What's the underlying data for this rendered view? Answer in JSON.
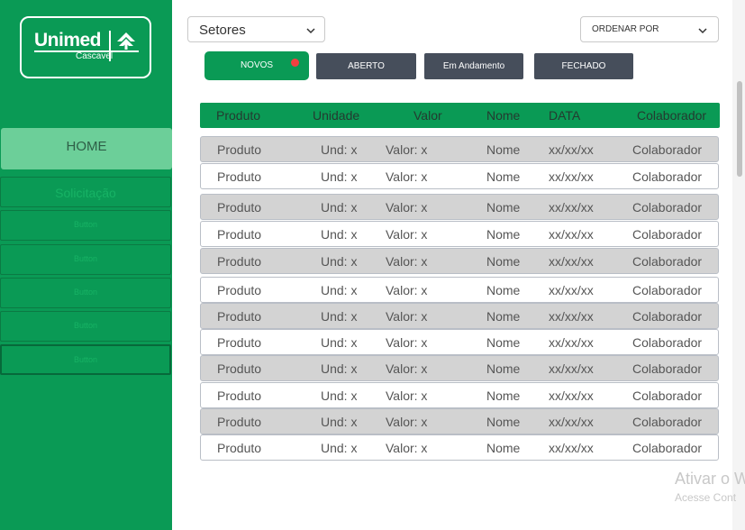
{
  "sidebar": {
    "logo": {
      "brand": "Unimed",
      "sub": "Cascavel"
    },
    "home_label": "HOME",
    "items": [
      {
        "label": "Solicitação"
      },
      {
        "label": "Button"
      },
      {
        "label": "Button"
      },
      {
        "label": "Button"
      },
      {
        "label": "Button"
      },
      {
        "label": "Button"
      }
    ]
  },
  "filters": {
    "setores": "Setores",
    "ordenar": "ORDENAR POR"
  },
  "tabs": {
    "novos": "NOVOS",
    "aberto": "ABERTO",
    "andamento": "Em Andamento",
    "fechado": "FECHADO"
  },
  "table": {
    "headers": [
      "Produto",
      "Unidade",
      "Valor",
      "Nome",
      "DATA",
      "Colaborador"
    ],
    "rows": [
      [
        "Produto",
        "Und: x",
        "Valor:  x",
        "Nome",
        "xx/xx/xx",
        "Colaborador"
      ],
      [
        "Produto",
        "Und: x",
        "Valor:  x",
        "Nome",
        "xx/xx/xx",
        "Colaborador"
      ],
      [
        "Produto",
        "Und: x",
        "Valor:  x",
        "Nome",
        "xx/xx/xx",
        "Colaborador"
      ],
      [
        "Produto",
        "Und: x",
        "Valor:  x",
        "Nome",
        "xx/xx/xx",
        "Colaborador"
      ],
      [
        "Produto",
        "Und: x",
        "Valor:  x",
        "Nome",
        "xx/xx/xx",
        "Colaborador"
      ],
      [
        "Produto",
        "Und: x",
        "Valor:  x",
        "Nome",
        "xx/xx/xx",
        "Colaborador"
      ],
      [
        "Produto",
        "Und: x",
        "Valor:  x",
        "Nome",
        "xx/xx/xx",
        "Colaborador"
      ],
      [
        "Produto",
        "Und: x",
        "Valor:  x",
        "Nome",
        "xx/xx/xx",
        "Colaborador"
      ],
      [
        "Produto",
        "Und: x",
        "Valor:  x",
        "Nome",
        "xx/xx/xx",
        "Colaborador"
      ],
      [
        "Produto",
        "Und: x",
        "Valor:  x",
        "Nome",
        "xx/xx/xx",
        "Colaborador"
      ],
      [
        "Produto",
        "Und: x",
        "Valor:  x",
        "Nome",
        "xx/xx/xx",
        "Colaborador"
      ],
      [
        "Produto",
        "Und: x",
        "Valor:  x",
        "Nome",
        "xx/xx/xx",
        "Colaborador"
      ]
    ]
  },
  "watermark": {
    "line1": "Ativar o W",
    "line2": "Acesse Cont"
  },
  "colors": {
    "brand_green": "#0a9a55",
    "home_highlight": "#6ccf99",
    "tab_dark": "#464e5b",
    "notify_dot": "#f24040",
    "row_grey": "#d3d3d3"
  },
  "icons": {
    "dropdown": "chevron-down-icon",
    "logo_mark": "unimed-tree-icon"
  }
}
